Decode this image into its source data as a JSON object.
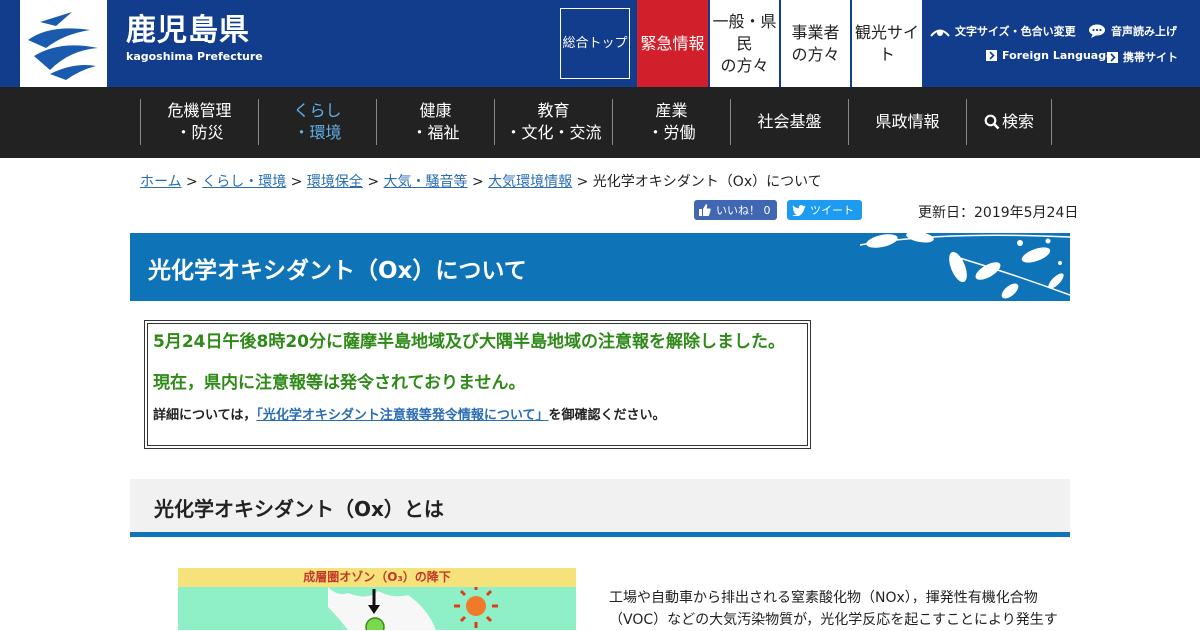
{
  "header": {
    "logo_jp": "鹿児島県",
    "logo_en": "kagoshima Prefecture",
    "nav": {
      "top": "総合トップ",
      "emergency": "緊急情報",
      "resident_l1": "一般・県",
      "resident_l2": "民",
      "resident_l3": "の方々",
      "biz_l1": "事業者",
      "biz_l2": "の方々",
      "tour_l1": "観光サイ",
      "tour_l2": "ト"
    },
    "utility": {
      "text_size": "文字サイズ・色合い変更",
      "voice": "音声読み上げ",
      "foreign": "Foreign Language",
      "mobile": "携帯サイト"
    },
    "colors": {
      "brand": "#123d8c",
      "emergency": "#d1202b"
    }
  },
  "global_nav": {
    "items": [
      {
        "l1": "危機管理",
        "l2": "・防災"
      },
      {
        "l1": "くらし",
        "l2": "・環境",
        "active": true
      },
      {
        "l1": "健康",
        "l2": "・福祉"
      },
      {
        "l1": "教育",
        "l2": "・文化・交流"
      },
      {
        "l1": "産業",
        "l2": "・労働"
      },
      {
        "l1": "社会基盤",
        "l2": ""
      },
      {
        "l1": "県政情報",
        "l2": ""
      },
      {
        "l1": "検索",
        "l2": ""
      }
    ]
  },
  "breadcrumb": {
    "home": "ホーム",
    "c1": "くらし・環境",
    "c2": "環境保全",
    "c3": "大気・騒音等",
    "c4": "大気環境情報",
    "sep": " > ",
    "current": "光化学オキシダント（Ox）について"
  },
  "social": {
    "like": "いいね！ 0",
    "tweet": "ツイート"
  },
  "updated": "更新日：2019年5月24日",
  "page_title": "光化学オキシダント（Ox）について",
  "notice": {
    "line1": "5月24日午後8時20分に薩摩半島地域及び大隅半島地域の注意報を解除しました。",
    "line2": "現在，県内に注意報等は発令されておりません。",
    "line3_pre": "詳細については，",
    "line3_link": "「光化学オキシダント注意報等発令情報について」",
    "line3_post": "を御確認ください。"
  },
  "section": {
    "title": "光化学オキシダント（Ox）とは"
  },
  "figure": {
    "caption": "成層圏オゾン（O₃）の降下"
  },
  "body": {
    "line1": "工場や自動車から排出される窒素酸化物（NOx），揮発性有機化合物",
    "line2": "（VOC）などの大気汚染物質が，光化学反応を起こすことにより発生す"
  }
}
